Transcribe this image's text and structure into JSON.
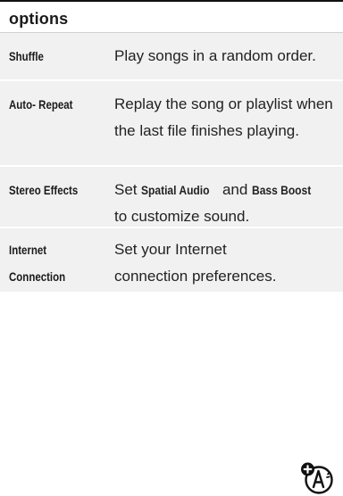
{
  "header": {
    "title": "options"
  },
  "rows": [
    {
      "option": "Shuffle",
      "description": "Play songs in a random order."
    },
    {
      "option": "Auto- Repeat",
      "description": "Replay the song or playlist when the last file finishes playing."
    },
    {
      "option": "Stereo Effects",
      "description_parts": {
        "prefix": "Set",
        "bold1": "Spatial Audio",
        "mid": "and",
        "bold2": "Bass Boost",
        "suffix": "to customize sound."
      }
    },
    {
      "option_line1": "Internet",
      "option_line2": "Connection",
      "description": "Set your Internet connection preferences.",
      "icon": "network-feature-icon"
    }
  ]
}
